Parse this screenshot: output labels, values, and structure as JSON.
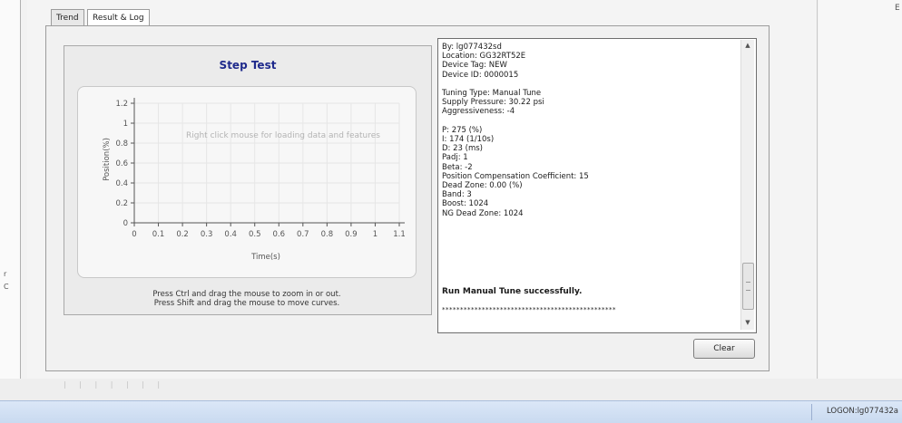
{
  "left_glyphs": [
    "r",
    "C"
  ],
  "right_glyph": "E",
  "tabs": [
    {
      "label": "Trend",
      "active": false
    },
    {
      "label": "Result & Log",
      "active": true
    }
  ],
  "chart": {
    "hint": [
      "Press Ctrl and drag the mouse to zoom in or out.",
      "Press Shift and drag the mouse to move curves."
    ]
  },
  "chart_data": {
    "type": "line",
    "title": "Step Test",
    "xlabel": "Time(s)",
    "ylabel": "Position(%)",
    "xlim": [
      0,
      1.1
    ],
    "ylim": [
      0,
      1.2
    ],
    "x_ticks": [
      "0",
      "0.1",
      "0.2",
      "0.3",
      "0.4",
      "0.5",
      "0.6",
      "0.7",
      "0.8",
      "0.9",
      "1",
      "1.1"
    ],
    "y_ticks": [
      "0",
      "0.2",
      "0.4",
      "0.6",
      "0.8",
      "1",
      "1.2"
    ],
    "grid": true,
    "series": [],
    "annotation": "Right click mouse for loading data and features"
  },
  "log": {
    "lines": [
      "By: lg077432sd",
      "Location: GG32RT52E",
      "Device Tag: NEW",
      "Device ID: 0000015",
      "",
      "Tuning Type: Manual Tune",
      "Supply Pressure: 30.22 psi",
      "Aggressiveness: -4",
      "",
      "P: 275 (%)",
      "I: 174 (1/10s)",
      "D: 23 (ms)",
      "Padj: 1",
      "Beta: -2",
      "Position Compensation Coefficient: 15",
      "Dead Zone: 0.00 (%)",
      "Band: 3",
      "Boost: 1024",
      "NG Dead Zone: 1024"
    ],
    "success": "Run Manual Tune successfully.",
    "separator": "************************************************"
  },
  "buttons": {
    "clear": "Clear"
  },
  "status": {
    "text": "LOGON:lg077432a"
  },
  "colors": {
    "title": "#1f2a8c",
    "accent": "#c9daf0"
  }
}
